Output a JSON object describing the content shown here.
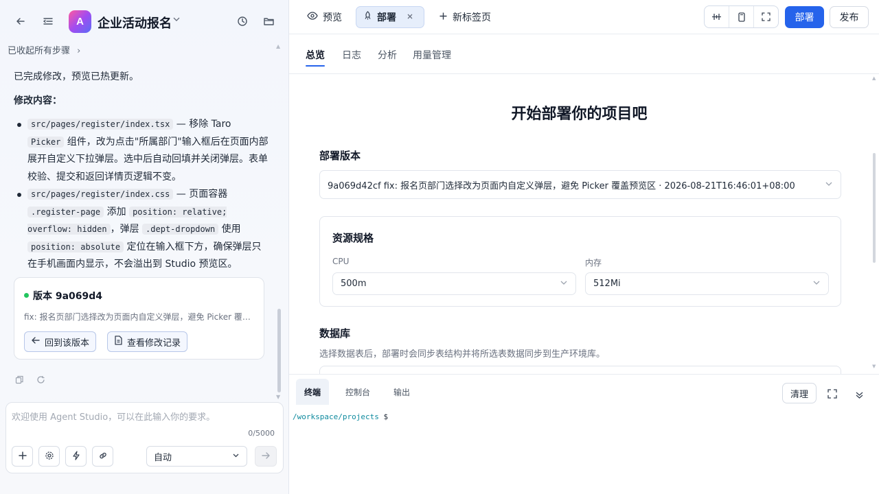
{
  "app": {
    "title": "企业活动报名",
    "logo_letter": "A"
  },
  "left": {
    "collapsed_text": "已收起所有步骤",
    "message": {
      "done": "已完成修改，预览已热更新。",
      "section_title": "修改内容：",
      "item1": {
        "file": "src/pages/register/index.tsx",
        "t1": " — 移除 Taro ",
        "code2": "Picker",
        "t2": " 组件，改为点击\"所属部门\"输入框后在页面内部展开自定义下拉弹层。选中后自动回填并关闭弹层。表单校验、提交和返回详情页逻辑不变。"
      },
      "item2": {
        "file": "src/pages/register/index.css",
        "t1": " — 页面容器 ",
        "code2": ".register-page",
        "t2": " 添加 ",
        "code3": "position: relative; overflow: hidden",
        "t3": "，弹层 ",
        "code4": ".dept-dropdown",
        "t4": " 使用 ",
        "code5": "position: absolute",
        "t5": " 定位在输入框下方，确保弹层只在手机画面内显示，不会溢出到 Studio 预览区。"
      }
    },
    "version_card": {
      "title": "版本 9a069d4",
      "desc": "fix: 报名页部门选择改为页面内自定义弹层，避免 Picker 覆盖预览区",
      "revert": "回到该版本",
      "history": "查看修改记录"
    },
    "composer": {
      "placeholder": "欢迎使用 Agent Studio，可以在此输入你的要求。",
      "counter": "0/5000",
      "mode": "自动"
    }
  },
  "right": {
    "tabs": {
      "preview": "预览",
      "deploy": "部署",
      "new_tab": "新标签页"
    },
    "deploy_btn": "部署",
    "publish_btn": "发布",
    "subtabs": [
      "总览",
      "日志",
      "分析",
      "用量管理"
    ],
    "heading": "开始部署你的项目吧",
    "version_label": "部署版本",
    "version_value": "9a069d42cf fix: 报名页部门选择改为页面内自定义弹层，避免 Picker 覆盖预览区 · 2026-08-21T16:46:01+08:00",
    "resources": {
      "title": "资源规格",
      "cpu_label": "CPU",
      "cpu_value": "500m",
      "mem_label": "内存",
      "mem_value": "512Mi"
    },
    "database": {
      "title": "数据库",
      "desc": "选择数据表后，部署时会同步表结构并将所选表数据同步到生产环境库。"
    },
    "terminal": {
      "tabs": [
        "终端",
        "控制台",
        "输出"
      ],
      "clear": "清理",
      "path": "/workspace/projects",
      "symbol": "$"
    }
  },
  "colors": {
    "primary": "#2563eb",
    "success": "#22c55e",
    "terminal_path": "#0e8a9e"
  }
}
